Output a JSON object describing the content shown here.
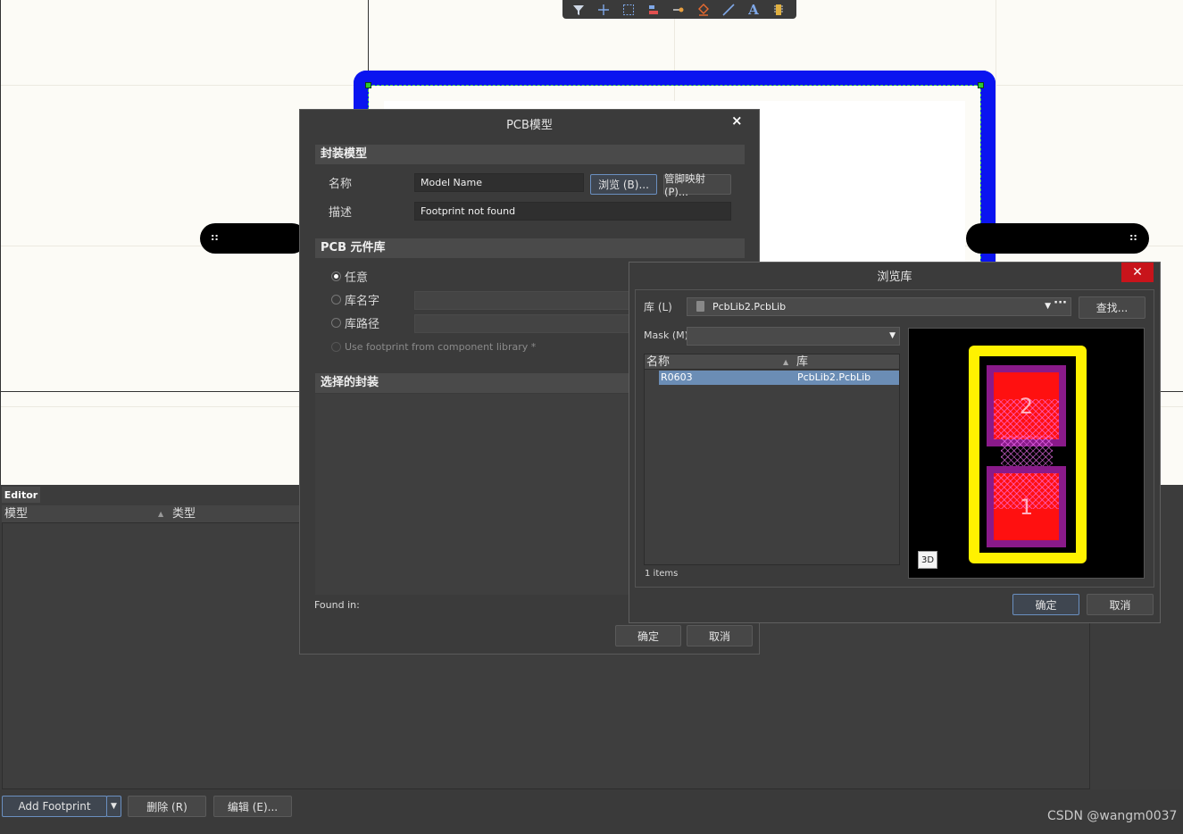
{
  "toolbar": {
    "icons": [
      "filter-icon",
      "add-icon",
      "select-rect-icon",
      "align-icon",
      "place-pin-icon",
      "fill-icon",
      "line-icon",
      "text-icon",
      "component-icon"
    ]
  },
  "pin_handles": {
    "left": "::",
    "right": "::"
  },
  "pcb_dialog": {
    "title": "PCB模型",
    "close": "×",
    "section_footprint": "封装模型",
    "name_label": "名称",
    "name_value": "Model Name",
    "browse_button": "浏览 (B)...",
    "pinmap_button": "管脚映射 (P)...",
    "desc_label": "描述",
    "desc_value": "Footprint not found",
    "section_lib": "PCB 元件库",
    "radio_any": "任意",
    "radio_libname": "库名字",
    "radio_libpath": "库路径",
    "use_footprint": "Use footprint from component library *",
    "section_selected": "选择的封装",
    "found_in": "Found in:",
    "ok": "确定",
    "cancel": "取消"
  },
  "browse_dialog": {
    "title": "浏览库",
    "close": "✕",
    "lib_label": "库 (L)",
    "lib_value": "PcbLib2.PcbLib",
    "find_button": "查找...",
    "mask_label": "Mask (M)",
    "mask_value": "",
    "col_name": "名称",
    "col_lib": "库",
    "rows": [
      {
        "name": "R0603",
        "lib": "PcbLib2.PcbLib"
      }
    ],
    "items_count": "1 items",
    "pad_top": "2",
    "pad_bottom": "1",
    "btn_3d": "3D",
    "ok": "确定",
    "cancel": "取消"
  },
  "editor": {
    "tab": "Editor",
    "col_model": "模型",
    "col_type": "类型",
    "add_footprint": "Add Footprint",
    "delete": "删除 (R)",
    "edit": "编辑 (E)..."
  },
  "watermark": "CSDN @wangm0037"
}
